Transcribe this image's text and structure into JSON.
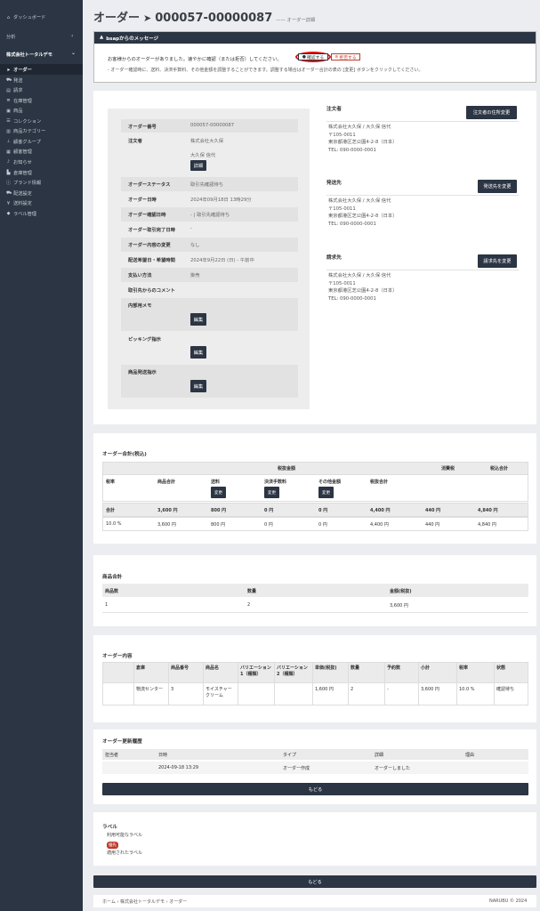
{
  "sidebar": {
    "dashboard": "ダッシュボード",
    "analytics": "分析",
    "analytics_caret": "‹",
    "company": "株式会社トータルデモ",
    "company_caret": "⌄",
    "items": [
      {
        "label": "オーダー",
        "icon": "paper-plane-icon"
      },
      {
        "label": "発送",
        "icon": "truck-icon"
      },
      {
        "label": "請求",
        "icon": "file-icon"
      },
      {
        "label": "在庫管理",
        "icon": "list-icon"
      },
      {
        "label": "商品",
        "icon": "box-icon"
      },
      {
        "label": "コレクション",
        "icon": "bars-icon"
      },
      {
        "label": "商品カテゴリー",
        "icon": "folder-icon"
      },
      {
        "label": "顧客グループ",
        "icon": "sitemap-icon"
      },
      {
        "label": "顧客管理",
        "icon": "user-icon"
      },
      {
        "label": "お知らせ",
        "icon": "bell-icon"
      },
      {
        "label": "倉庫管理",
        "icon": "warehouse-icon"
      },
      {
        "label": "ブランド情報",
        "icon": "info-icon"
      },
      {
        "label": "配送設定",
        "icon": "truck-icon"
      },
      {
        "label": "送料設定",
        "icon": "yen-icon"
      },
      {
        "label": "ラベル管理",
        "icon": "tag-icon"
      }
    ]
  },
  "header": {
    "title": "オーダー",
    "order_no": "000057-00000087",
    "subtitle": "オーダー詳細"
  },
  "message": {
    "head": "bsapからのメッセージ",
    "line1": "お客様からのオーダーがありました。速やかに確認（または拒否）してください。",
    "confirm": "確認する",
    "reject": "拒否する",
    "line2": "- オーダー確認時に、送料、決済手数料、その他金額を調整することができます。調整する場合はオーダー合計の表の [変更] ボタンをクリックしてください。"
  },
  "details": {
    "order_no_k": "オーダー番号",
    "order_no_v": "000057-00000087",
    "orderer_k": "注文者",
    "orderer_v1": "株式会社大久保",
    "orderer_v2": "大久保 信代",
    "detail_btn": "詳細",
    "status_k": "オーダーステータス",
    "status_v": "取引先確認待ち",
    "date_k": "オーダー日時",
    "date_v": "2024年09月18日 13時29分",
    "confirm_k": "オーダー確認日時",
    "confirm_v": "- | 取引先確認待ち",
    "complete_k": "オーダー取引完了日時",
    "complete_v": "-",
    "change_k": "オーダー内容の変更",
    "change_v": "なし",
    "delivery_k": "配送希望日・希望時間",
    "delivery_v": "2024年9月22日 (日) - 午前中",
    "pay_k": "支払い方法",
    "pay_v": "掛売",
    "comment_k": "取引先からのコメント",
    "memo_k": "内部用メモ",
    "edit": "編集",
    "picking_k": "ピッキング指示",
    "ship_k": "商品発送指示"
  },
  "addresses": [
    {
      "title": "注文者",
      "btn": "注文者の住所変更",
      "lines": [
        "株式会社大久保 / 大久保 信代",
        "〒105-0011",
        "東京都港区芝公園4-2-8（日本）",
        "TEL: 090-0000-0001"
      ]
    },
    {
      "title": "発送先",
      "btn": "発送先を変更",
      "lines": [
        "株式会社大久保 / 大久保 信代",
        "〒105-0011",
        "東京都港区芝公園4-2-8（日本）",
        "TEL: 090-0000-0001"
      ]
    },
    {
      "title": "請求先",
      "btn": "請求先を変更",
      "lines": [
        "株式会社大久保 / 大久保 信代",
        "〒105-0011",
        "東京都港区芝公園4-2-8（日本）",
        "TEL: 090-0000-0001"
      ]
    }
  ],
  "totals": {
    "title": "オーダー合計(税込)",
    "h_taxbase": "税抜金額",
    "h_tax": "消費税",
    "h_total": "税込合計",
    "cols": [
      "税率",
      "商品合計",
      "送料",
      "決済手数料",
      "その他金額",
      "税抜合計"
    ],
    "change": "変更",
    "sum_row": [
      "合計",
      "3,600 円",
      "800 円",
      "0 円",
      "0 円",
      "4,400 円",
      "440 円",
      "4,840 円"
    ],
    "rate_row": [
      "10.0 %",
      "3,600 円",
      "800 円",
      "0 円",
      "0 円",
      "4,400 円",
      "440 円",
      "4,840 円"
    ]
  },
  "products_total": {
    "title": "商品合計",
    "cols": [
      "商品数",
      "数量",
      "金額(税抜)"
    ],
    "row": [
      "1",
      "2",
      "3,600 円"
    ]
  },
  "contents": {
    "title": "オーダー内容",
    "cols": [
      "倉庫",
      "商品番号",
      "商品名",
      "バリエーション1（種類）",
      "バリエーション2（種類）",
      "単価(税抜)",
      "数量",
      "予約数",
      "小計",
      "税率",
      "状態"
    ],
    "row": [
      "物流センター",
      "3",
      "モイスチャークリーム",
      "",
      "",
      "1,600 円",
      "2",
      "-",
      "3,600 円",
      "10.0 %",
      "確認待ち"
    ]
  },
  "history": {
    "title": "オーダー更新履歴",
    "cols": [
      "担当者",
      "日時",
      "タイプ",
      "詳細",
      "理由"
    ],
    "row": [
      "",
      "2024-09-18 13:29",
      "オーダー作成",
      "オーダーしました",
      ""
    ],
    "back": "もどる"
  },
  "labels": {
    "title": "ラベル",
    "available": "利用可能なラベル",
    "badge": "優先",
    "applied": "適用されたラベル"
  },
  "back": "もどる",
  "footer": {
    "breadcrumb": [
      "ホーム",
      "株式会社トータルデモ",
      "オーダー"
    ],
    "copyright": "NARUBU © 2024"
  }
}
